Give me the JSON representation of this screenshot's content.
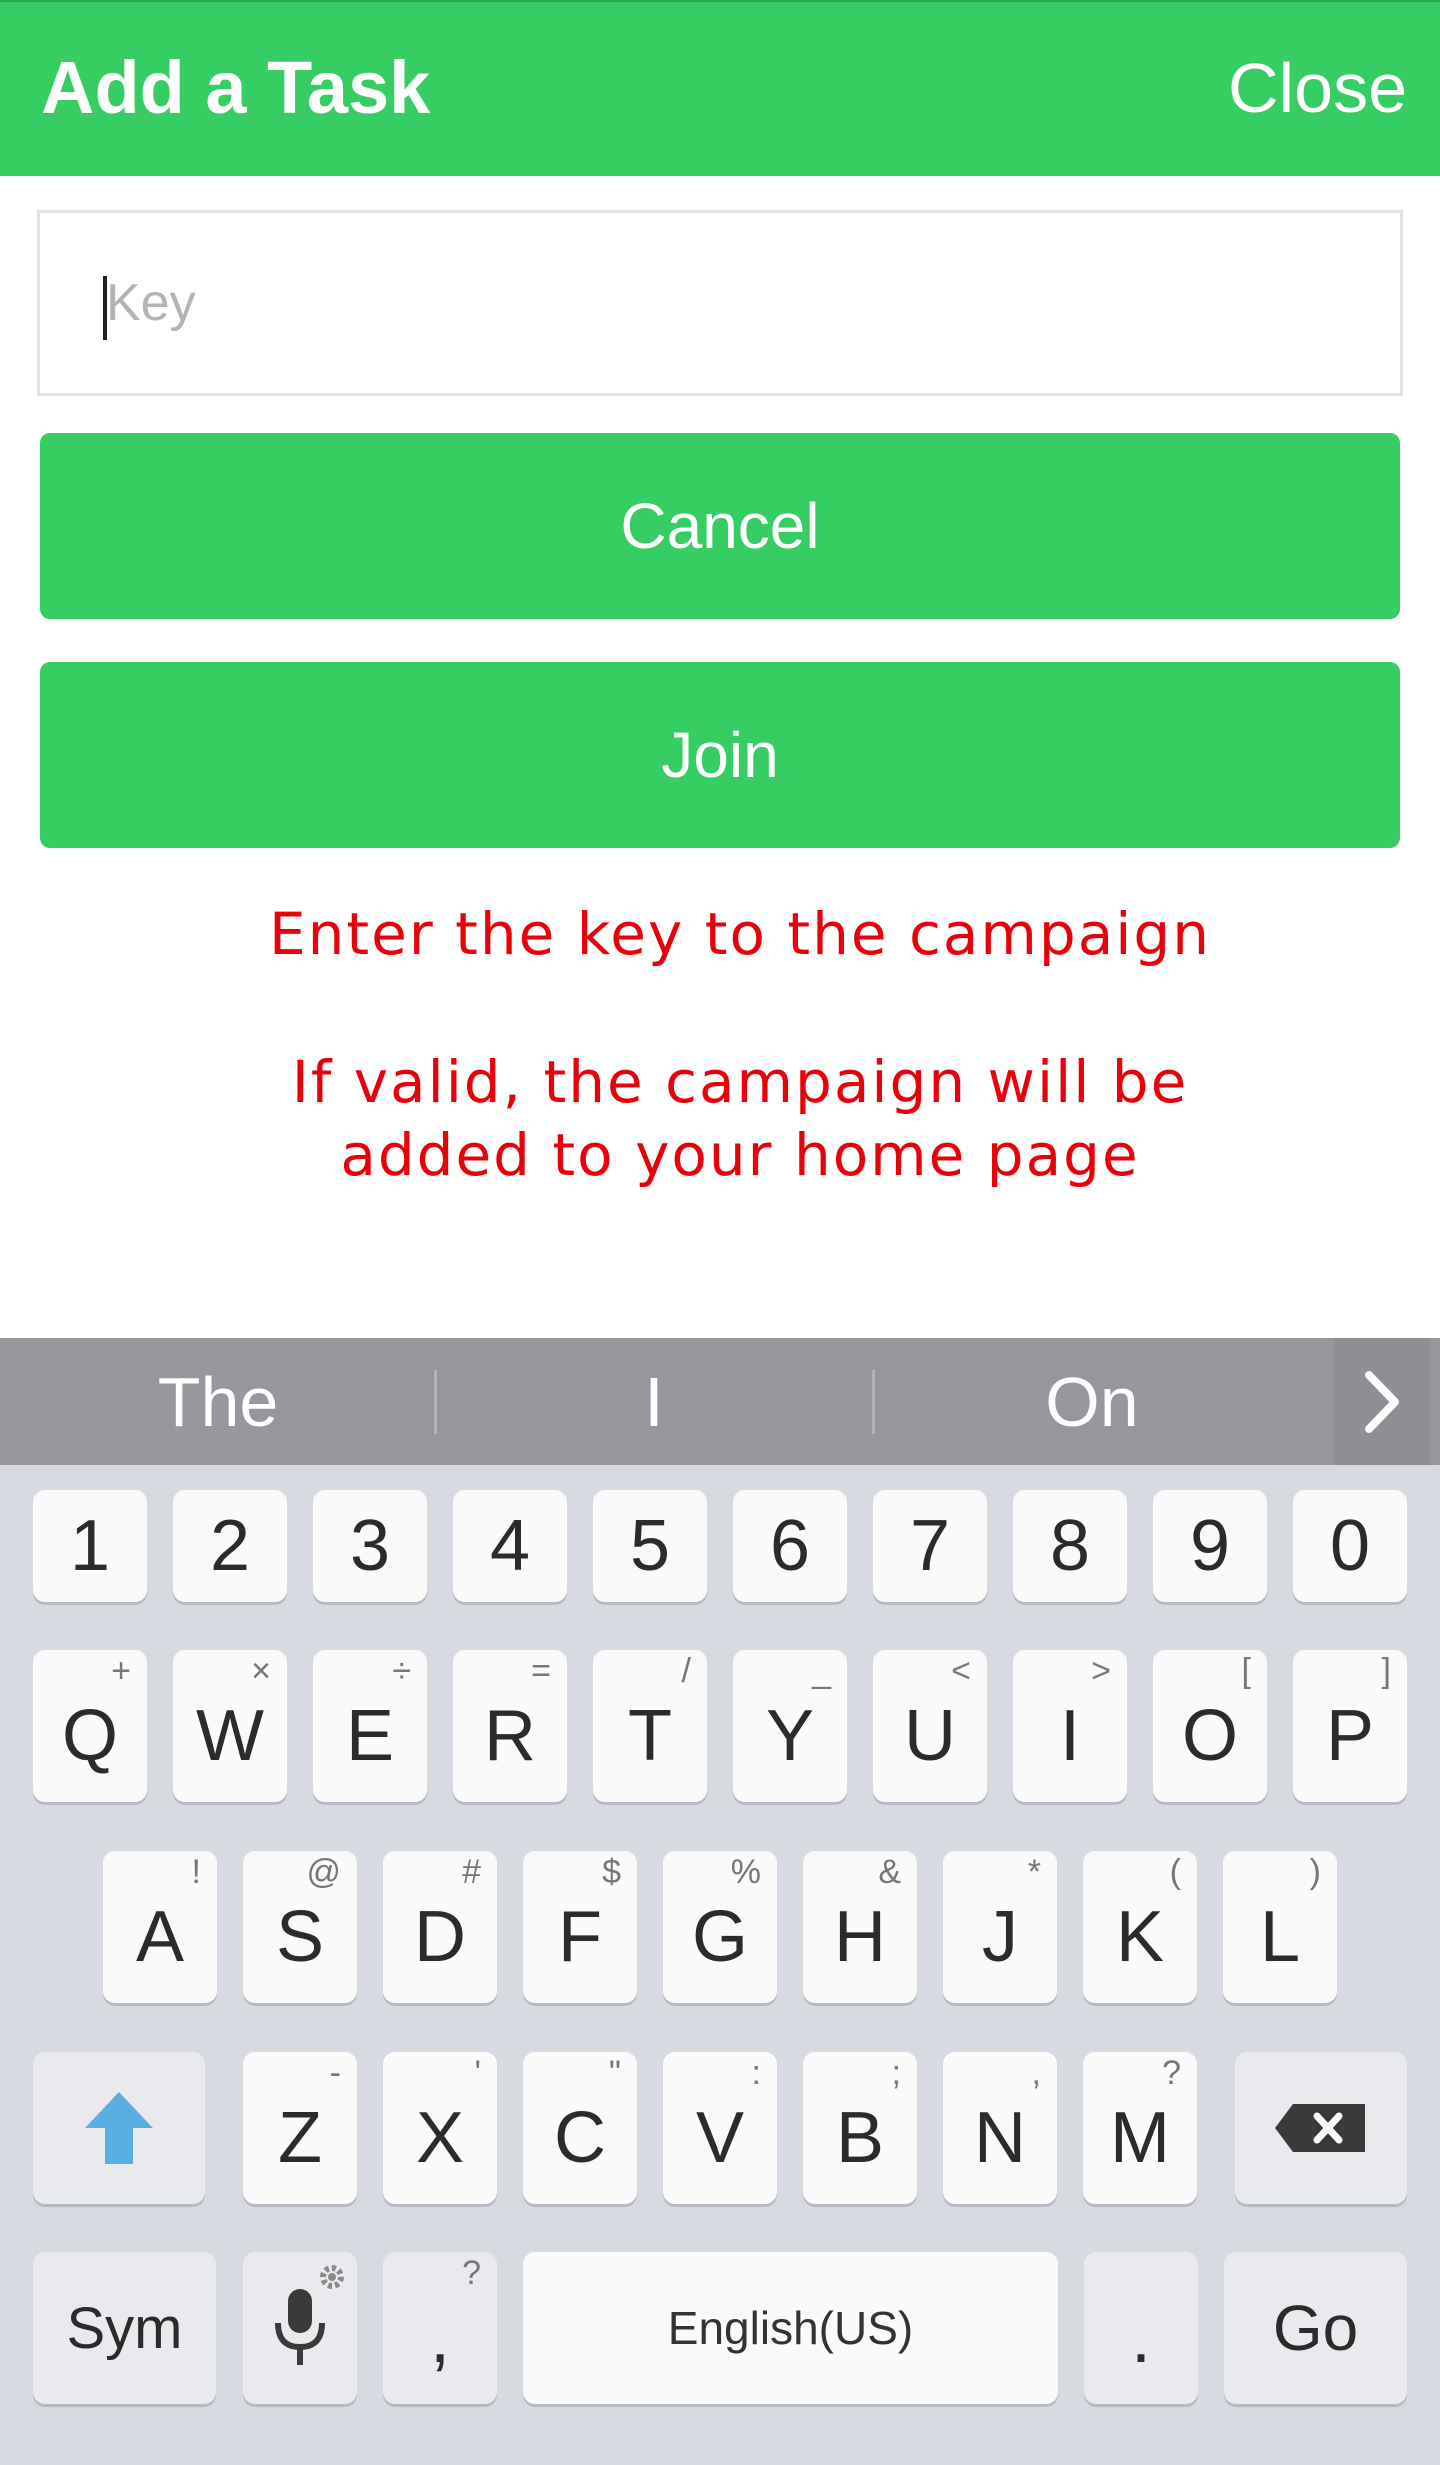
{
  "header": {
    "title": "Add a Task",
    "close_label": "Close"
  },
  "form": {
    "key_placeholder": "Key",
    "cancel_label": "Cancel",
    "join_label": "Join",
    "help_line1": "Enter the key to the campaign",
    "help_line2a": "If valid, the campaign will be",
    "help_line2b": "added to your home page"
  },
  "keyboard": {
    "suggestions": [
      "The",
      "I",
      "On"
    ],
    "numbers": [
      "1",
      "2",
      "3",
      "4",
      "5",
      "6",
      "7",
      "8",
      "9",
      "0"
    ],
    "row1": [
      {
        "k": "Q",
        "s": "+"
      },
      {
        "k": "W",
        "s": "×"
      },
      {
        "k": "E",
        "s": "÷"
      },
      {
        "k": "R",
        "s": "="
      },
      {
        "k": "T",
        "s": "/"
      },
      {
        "k": "Y",
        "s": "_"
      },
      {
        "k": "U",
        "s": "<"
      },
      {
        "k": "I",
        "s": ">"
      },
      {
        "k": "O",
        "s": "["
      },
      {
        "k": "P",
        "s": "]"
      }
    ],
    "row2": [
      {
        "k": "A",
        "s": "!"
      },
      {
        "k": "S",
        "s": "@"
      },
      {
        "k": "D",
        "s": "#"
      },
      {
        "k": "F",
        "s": "$"
      },
      {
        "k": "G",
        "s": "%"
      },
      {
        "k": "H",
        "s": "&"
      },
      {
        "k": "J",
        "s": "*"
      },
      {
        "k": "K",
        "s": "("
      },
      {
        "k": "L",
        "s": ")"
      }
    ],
    "row3": [
      {
        "k": "Z",
        "s": "-"
      },
      {
        "k": "X",
        "s": "'"
      },
      {
        "k": "C",
        "s": "\""
      },
      {
        "k": "V",
        "s": ":"
      },
      {
        "k": "B",
        "s": ";"
      },
      {
        "k": "N",
        "s": ","
      },
      {
        "k": "M",
        "s": "?"
      }
    ],
    "sym_label": "Sym",
    "comma_label": ",",
    "comma_sub": "?",
    "space_label": "English(US)",
    "period_label": ".",
    "go_label": "Go"
  },
  "colors": {
    "accent": "#36cd62",
    "error_text": "#e8000b",
    "shift_arrow": "#5aaee0"
  }
}
